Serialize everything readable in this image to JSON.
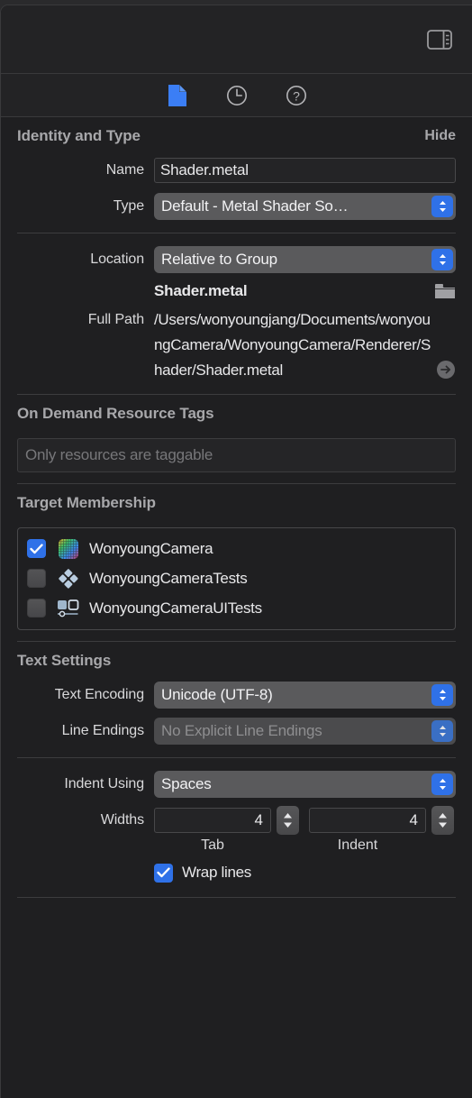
{
  "toolbar": {
    "panel_toggle_icon": "inspector-panel-toggle-icon"
  },
  "tabs": [
    {
      "name": "file-inspector-tab",
      "icon": "document-icon",
      "active": true
    },
    {
      "name": "history-inspector-tab",
      "icon": "clock-icon",
      "active": false
    },
    {
      "name": "quick-help-inspector-tab",
      "icon": "question-circle-icon",
      "active": false
    }
  ],
  "identity": {
    "title": "Identity and Type",
    "hide_label": "Hide",
    "name_label": "Name",
    "name_value": "Shader.metal",
    "type_label": "Type",
    "type_value": "Default - Metal Shader So…",
    "location_label": "Location",
    "location_value": "Relative to Group",
    "location_file": "Shader.metal",
    "full_path_label": "Full Path",
    "full_path_value": "/Users/wonyoungjang/Documents/wonyoungCamera/WonyoungCamera/Renderer/Shader/Shader.metal"
  },
  "odr": {
    "title": "On Demand Resource Tags",
    "placeholder": "Only resources are taggable"
  },
  "target_membership": {
    "title": "Target Membership",
    "items": [
      {
        "label": "WonyoungCamera",
        "checked": true,
        "icon": "app-grid-icon"
      },
      {
        "label": "WonyoungCameraTests",
        "checked": false,
        "icon": "unit-test-diamond-icon"
      },
      {
        "label": "WonyoungCameraUITests",
        "checked": false,
        "icon": "ui-test-window-icon"
      }
    ]
  },
  "text_settings": {
    "title": "Text Settings",
    "encoding_label": "Text Encoding",
    "encoding_value": "Unicode (UTF-8)",
    "line_endings_label": "Line Endings",
    "line_endings_value": "No Explicit Line Endings",
    "indent_label": "Indent Using",
    "indent_value": "Spaces",
    "widths_label": "Widths",
    "tab_width": "4",
    "indent_width": "4",
    "tab_sublabel": "Tab",
    "indent_sublabel": "Indent",
    "wrap_lines_label": "Wrap lines",
    "wrap_lines_checked": true
  },
  "colors": {
    "accent_blue": "#2f71e8",
    "panel_bg": "#1f1f21",
    "toolbar_bg": "#232325",
    "popup_bg": "#5a5a5c",
    "text_primary": "#e8e8ea",
    "text_secondary": "#a8a8ab",
    "text_dim": "#77777a"
  }
}
